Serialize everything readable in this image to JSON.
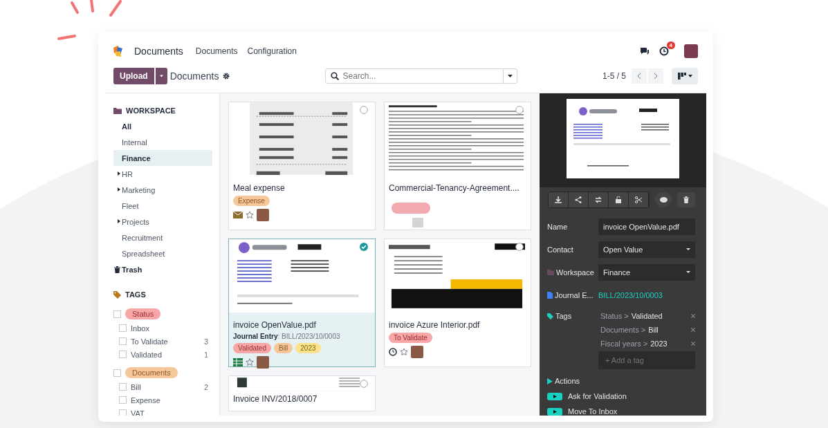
{
  "navbar": {
    "app_name": "Documents",
    "menu": [
      "Documents",
      "Configuration"
    ],
    "activity_count": "4"
  },
  "control_panel": {
    "upload": "Upload",
    "breadcrumb": "Documents",
    "search_placeholder": "Search...",
    "pager": "1-5 / 5"
  },
  "sidebar": {
    "workspace_title": "WORKSPACE",
    "workspaces": [
      {
        "label": "All",
        "selected": false,
        "strong": true,
        "expandable": false
      },
      {
        "label": "Internal",
        "selected": false,
        "strong": false,
        "expandable": false
      },
      {
        "label": "Finance",
        "selected": true,
        "strong": true,
        "expandable": false
      },
      {
        "label": "HR",
        "selected": false,
        "strong": false,
        "expandable": true
      },
      {
        "label": "Marketing",
        "selected": false,
        "strong": false,
        "expandable": true
      },
      {
        "label": "Fleet",
        "selected": false,
        "strong": false,
        "expandable": false
      },
      {
        "label": "Projects",
        "selected": false,
        "strong": false,
        "expandable": true
      },
      {
        "label": "Recruitment",
        "selected": false,
        "strong": false,
        "expandable": false
      },
      {
        "label": "Spreadsheet",
        "selected": false,
        "strong": false,
        "expandable": false
      }
    ],
    "trash": "Trash",
    "tags_title": "TAGS",
    "tag_groups": [
      {
        "label": "Status",
        "color": "#f7a7a7",
        "checked": false,
        "items": [
          {
            "label": "Inbox",
            "checked": false
          },
          {
            "label": "To Validate",
            "count": "3",
            "checked": false
          },
          {
            "label": "Validated",
            "count": "1",
            "checked": false
          }
        ]
      },
      {
        "label": "Documents",
        "color": "#f6c79b",
        "checked": false,
        "items": [
          {
            "label": "Bill",
            "count": "2",
            "checked": false
          },
          {
            "label": "Expense",
            "checked": false
          },
          {
            "label": "VAT",
            "checked": false
          }
        ]
      }
    ]
  },
  "cards": [
    {
      "title": "Meal expense",
      "selected": false,
      "tags": [
        {
          "label": "Expense",
          "color": "#f6c79b"
        }
      ],
      "starred": false
    },
    {
      "title": "Commercial-Tenancy-Agreement....",
      "selected": false
    },
    {
      "title": "invoice OpenValue.pdf",
      "selected": true,
      "journal": "**Journal Entry**: BILL/2023/10/0003",
      "tags": [
        {
          "label": "Validated",
          "color": "#f7a7a7"
        },
        {
          "label": "Bill",
          "color": "#f6c79b"
        },
        {
          "label": "2023",
          "color": "#fde28c"
        }
      ],
      "starred": false
    },
    {
      "title": "invoice Azure Interior.pdf",
      "selected": false,
      "tags": [
        {
          "label": "To Validate",
          "color": "#f7a7a7"
        }
      ],
      "starred": false
    },
    {
      "title": "Invoice INV/2018/0007",
      "selected": false
    }
  ],
  "details": {
    "fields": [
      {
        "kind": "input",
        "label": "Name",
        "value": "invoice OpenValue.pdf"
      },
      {
        "kind": "select",
        "label": "Contact",
        "value": "Open Value"
      },
      {
        "kind": "select",
        "label": "Workspace",
        "value": "Finance"
      },
      {
        "kind": "link",
        "label": "Journal E...",
        "value": "BILL/2023/10/0003"
      }
    ],
    "tags_label": "Tags",
    "tags": [
      {
        "path": "Status >",
        "value": "Validated"
      },
      {
        "path": "Documents >",
        "value": "Bill"
      },
      {
        "path": "Fiscal years >",
        "value": "2023"
      }
    ],
    "add_tag_placeholder": "+ Add a tag",
    "actions_label": "Actions",
    "actions": [
      "Ask for Validation",
      "Move To Inbox"
    ]
  }
}
